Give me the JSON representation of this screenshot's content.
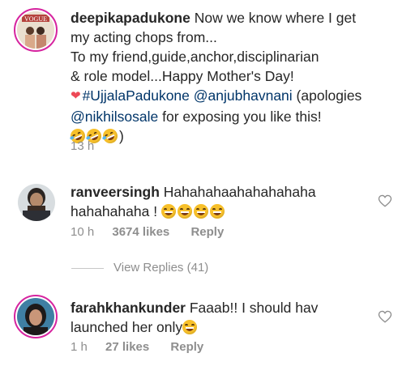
{
  "comments": [
    {
      "username": "deepikapadukone",
      "lines": [
        "Now we know where I get",
        "my acting chops from...",
        "To my friend,guide,anchor,disciplinarian",
        "& role model...Happy Mother's Day!"
      ],
      "hashtag": "#UjjalaPadukone",
      "mention1": "@anjubhavnani",
      "after_mention1": "(apologies",
      "mention2": "@nikhilsosale",
      "after_mention2": "for exposing you like this!",
      "closing": ")",
      "heart_emoji": "❤",
      "emoji_name": "rolling-on-floor-laughing",
      "time": "13 h"
    },
    {
      "username": "ranveersingh",
      "line1": "Hahahahaahahahahaha",
      "line2": "hahahahaha !",
      "emoji_name": "grinning-squinting-face",
      "time": "10 h",
      "likes": "3674 likes",
      "reply": "Reply"
    },
    {
      "username": "farahkhankunder",
      "line1": "Faaab!! I should hav",
      "line2": "launched her only",
      "emoji_name": "grinning-squinting-face",
      "time": "1 h",
      "likes": "27 likes",
      "reply": "Reply"
    }
  ],
  "view_replies": "View Replies (41)",
  "colors": {
    "text": "#262626",
    "secondary": "#8e8e8e",
    "link": "#003569",
    "story_ring": "#d6249f",
    "heart": "#ed4956"
  }
}
